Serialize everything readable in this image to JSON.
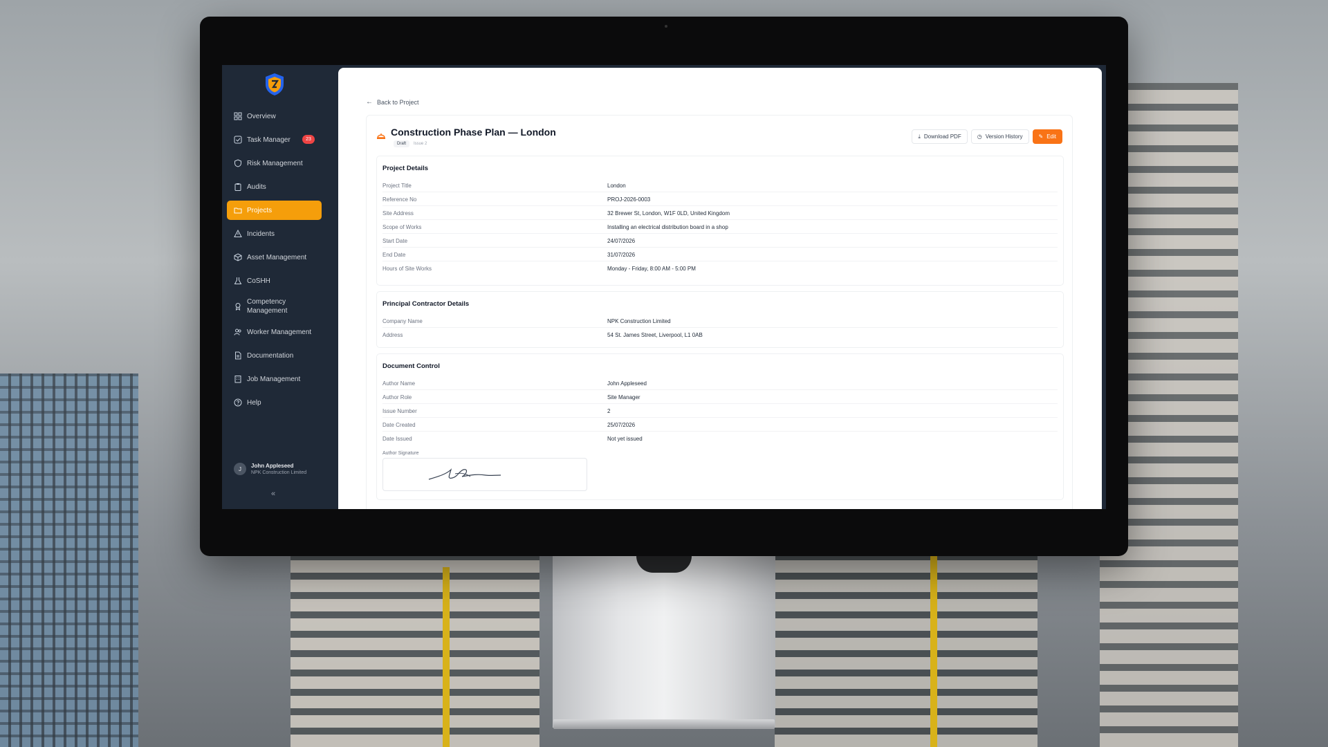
{
  "sidebar": {
    "items": [
      {
        "label": "Overview",
        "icon": "grid-icon"
      },
      {
        "label": "Task Manager",
        "icon": "checkbox-icon",
        "badge": "23"
      },
      {
        "label": "Risk Management",
        "icon": "shield-icon"
      },
      {
        "label": "Audits",
        "icon": "clipboard-icon"
      },
      {
        "label": "Projects",
        "icon": "folder-icon",
        "active": true
      },
      {
        "label": "Incidents",
        "icon": "warning-icon"
      },
      {
        "label": "Asset Management",
        "icon": "box-icon"
      },
      {
        "label": "CoSHH",
        "icon": "flask-icon"
      },
      {
        "label": "Competency Management",
        "icon": "award-icon"
      },
      {
        "label": "Worker Management",
        "icon": "users-icon"
      },
      {
        "label": "Documentation",
        "icon": "document-icon"
      },
      {
        "label": "Job Management",
        "icon": "building-icon"
      },
      {
        "label": "Help",
        "icon": "help-icon"
      }
    ],
    "user": {
      "initial": "J",
      "name": "John Appleseed",
      "company": "NPK Construction Limited"
    },
    "collapse_label": "«"
  },
  "main": {
    "back_label": "Back to Project",
    "title": "Construction Phase Plan — London",
    "status": "Draft",
    "issue": "Issue 2",
    "actions": {
      "download": "Download PDF",
      "history": "Version History",
      "edit": "Edit"
    },
    "sections": {
      "project": {
        "title": "Project Details",
        "rows": [
          {
            "k": "Project Title",
            "v": "London"
          },
          {
            "k": "Reference No",
            "v": "PROJ-2026-0003"
          },
          {
            "k": "Site Address",
            "v": "32 Brewer St, London, W1F 0LD, United Kingdom"
          },
          {
            "k": "Scope of Works",
            "v": "Installing an electrical distribution board in a shop"
          },
          {
            "k": "Start Date",
            "v": "24/07/2026"
          },
          {
            "k": "End Date",
            "v": "31/07/2026"
          },
          {
            "k": "Hours of Site Works",
            "v": "Monday - Friday, 8:00 AM - 5:00 PM"
          }
        ]
      },
      "contractor": {
        "title": "Principal Contractor Details",
        "rows": [
          {
            "k": "Company Name",
            "v": "NPK Construction Limited"
          },
          {
            "k": "Address",
            "v": "54 St. James Street, Liverpool, L1 0AB"
          }
        ]
      },
      "control": {
        "title": "Document Control",
        "rows": [
          {
            "k": "Author Name",
            "v": "John Appleseed"
          },
          {
            "k": "Author Role",
            "v": "Site Manager"
          },
          {
            "k": "Issue Number",
            "v": "2"
          },
          {
            "k": "Date Created",
            "v": "25/07/2026"
          },
          {
            "k": "Date Issued",
            "v": "Not yet issued"
          }
        ],
        "signature_label": "Author Signature"
      }
    }
  },
  "colors": {
    "accent": "#f59e0b",
    "edit_button": "#f97316",
    "badge": "#ef4444",
    "sidebar_bg": "#1f2937"
  }
}
